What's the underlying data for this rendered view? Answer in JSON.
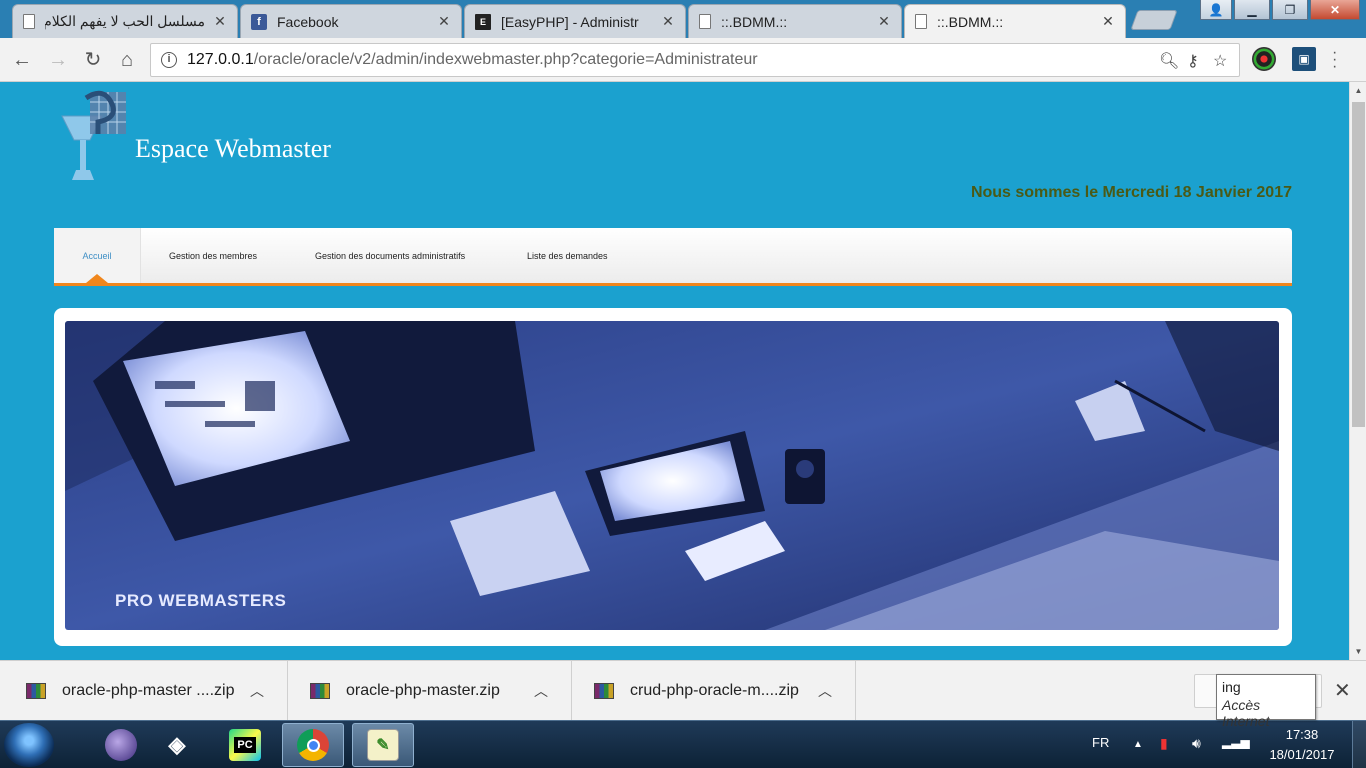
{
  "browser": {
    "tabs": [
      {
        "title": "مسلسل الحب لا يفهم الكلام ال",
        "favicon": "page-icon",
        "active": false
      },
      {
        "title": "Facebook",
        "favicon": "facebook-icon",
        "active": false
      },
      {
        "title": "[EasyPHP] - Administr",
        "favicon": "easyphp-icon",
        "active": false
      },
      {
        "title": "::.BDMM.::",
        "favicon": "page-icon",
        "active": false
      },
      {
        "title": "::.BDMM.::",
        "favicon": "page-icon",
        "active": true
      }
    ],
    "address": {
      "host": "127.0.0.1",
      "path": "/oracle/oracle/v2/admin/indexwebmaster.php?categorie=Administrateur"
    }
  },
  "page": {
    "site_title": "Espace Webmaster",
    "date_line": "Nous sommes le Mercredi 18 Janvier 2017",
    "menu": [
      {
        "label": "Accueil",
        "active": true
      },
      {
        "label": "Gestion des membres",
        "active": false
      },
      {
        "label": "Gestion des documents administratifs",
        "active": false
      },
      {
        "label": "Liste des demandes",
        "active": false
      }
    ],
    "banner_caption": "PRO WEBMASTERS"
  },
  "downloads": {
    "items": [
      {
        "name": "oracle-php-master ....zip",
        "icon": "winrar-icon"
      },
      {
        "name": "oracle-php-master.zip",
        "icon": "winrar-icon"
      },
      {
        "name": "crud-php-oracle-m....zip",
        "icon": "winrar-icon"
      }
    ],
    "tooltip": {
      "line1": "ing",
      "line2": "Accès Internet"
    }
  },
  "taskbar": {
    "apps": [
      "internet-explorer-icon",
      "eclipse-icon",
      "unity-icon",
      "pycharm-icon",
      "chrome-icon",
      "notepad-plus-plus-icon"
    ],
    "pycharm_label": "PC",
    "language": "FR",
    "time": "17:38",
    "date": "18/01/2017"
  },
  "colors": {
    "page_background": "#1ba1cf",
    "menu_accent": "#f0861c",
    "date_text": "#4a5a16",
    "active_menu_text": "#3f8fc5"
  }
}
